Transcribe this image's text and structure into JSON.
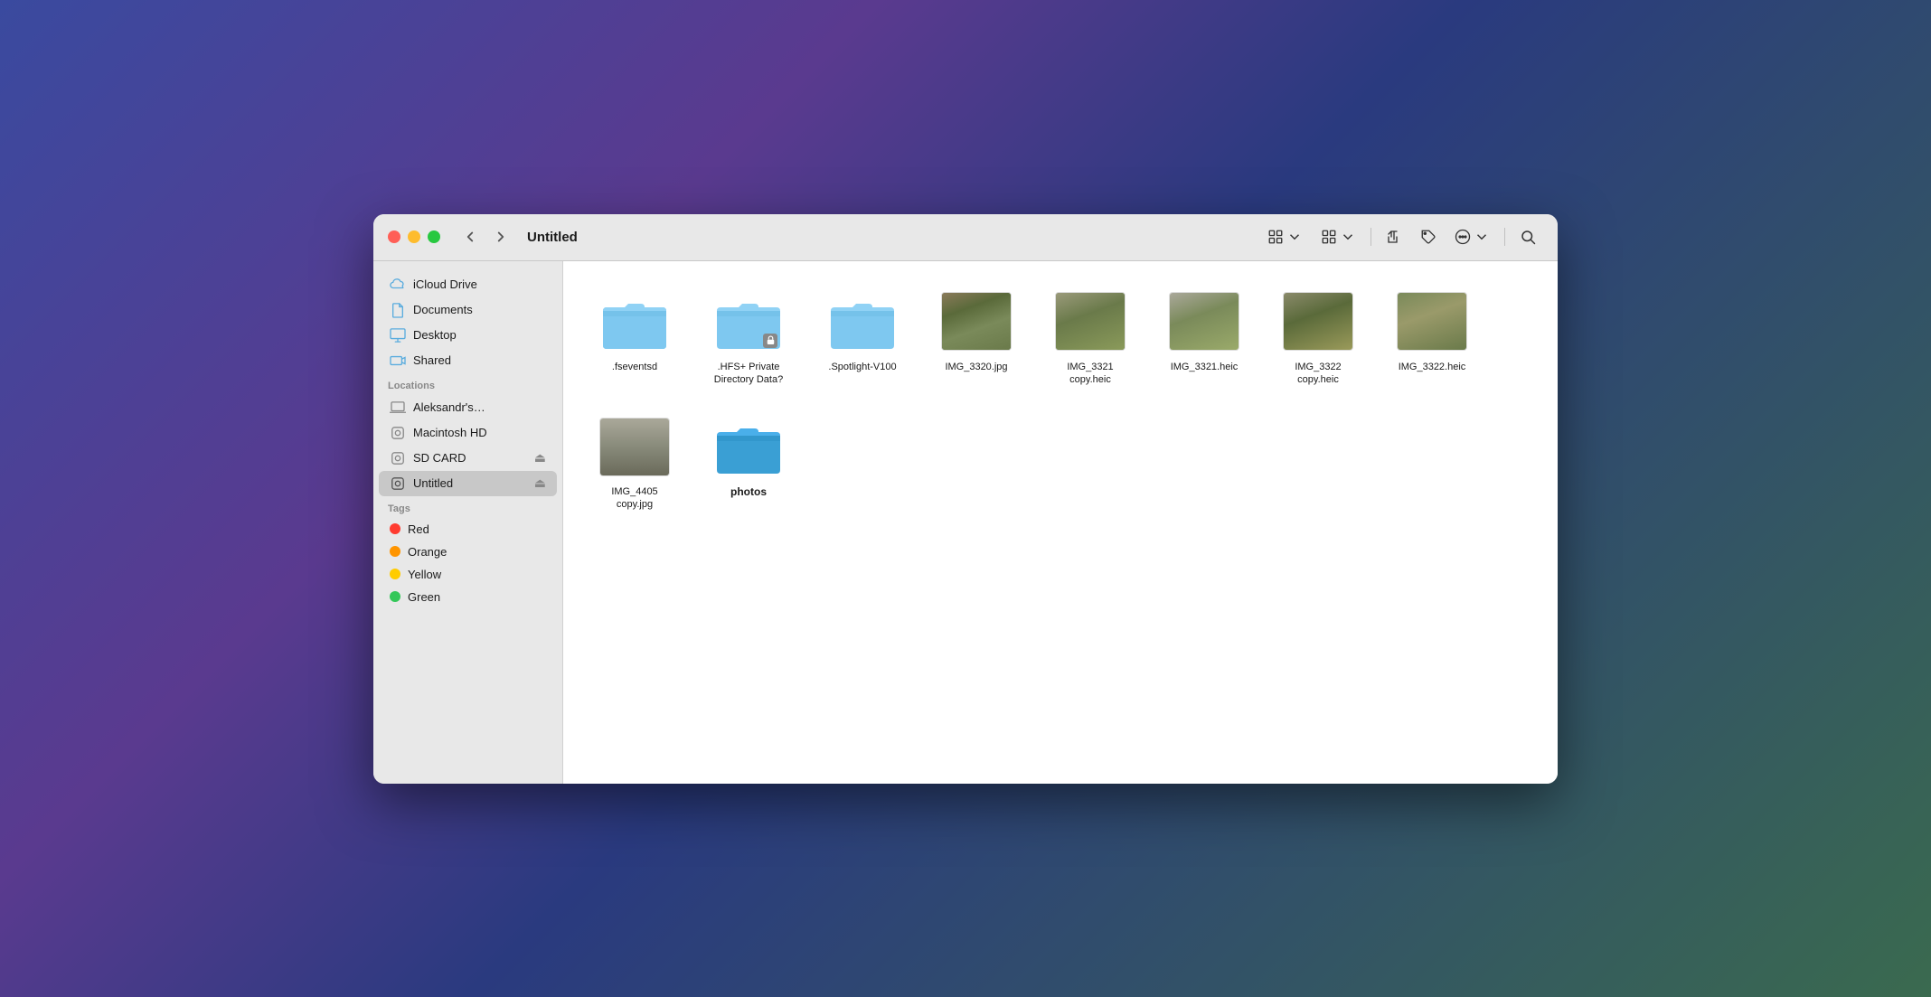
{
  "window": {
    "title": "Untitled"
  },
  "toolbar": {
    "back_label": "‹",
    "forward_label": "›",
    "title": "Untitled"
  },
  "sidebar": {
    "favorites": [
      {
        "id": "icloud-drive",
        "label": "iCloud Drive",
        "icon": "cloud"
      },
      {
        "id": "documents",
        "label": "Documents",
        "icon": "doc"
      },
      {
        "id": "desktop",
        "label": "Desktop",
        "icon": "desktop"
      },
      {
        "id": "shared",
        "label": "Shared",
        "icon": "shared"
      }
    ],
    "locations_header": "Locations",
    "locations": [
      {
        "id": "aleksandrs",
        "label": "Aleksandr's…",
        "icon": "laptop",
        "eject": false
      },
      {
        "id": "macintosh-hd",
        "label": "Macintosh HD",
        "icon": "disk",
        "eject": false
      },
      {
        "id": "sd-card",
        "label": "SD CARD",
        "icon": "disk",
        "eject": true
      },
      {
        "id": "untitled",
        "label": "Untitled",
        "icon": "disk",
        "eject": true,
        "active": true
      }
    ],
    "tags_header": "Tags",
    "tags": [
      {
        "id": "red",
        "label": "Red",
        "color": "#ff3b30"
      },
      {
        "id": "orange",
        "label": "Orange",
        "color": "#ff9500"
      },
      {
        "id": "yellow",
        "label": "Yellow",
        "color": "#ffcc00"
      },
      {
        "id": "green",
        "label": "Green",
        "color": "#34c759"
      }
    ]
  },
  "files": [
    {
      "id": "fseventsd",
      "name": ".fseventsd",
      "type": "folder",
      "dark": false
    },
    {
      "id": "hfs-private",
      "name": ".HFS+ Private Directory Data?",
      "type": "folder",
      "dark": false,
      "lock": true
    },
    {
      "id": "spotlight",
      "name": ".Spotlight-V100",
      "type": "folder",
      "dark": false
    },
    {
      "id": "img3320",
      "name": "IMG_3320.jpg",
      "type": "photo",
      "variant": 1
    },
    {
      "id": "img3321copy",
      "name": "IMG_3321 copy.heic",
      "type": "photo",
      "variant": 2
    },
    {
      "id": "img3321",
      "name": "IMG_3321.heic",
      "type": "photo",
      "variant": 3
    },
    {
      "id": "img3322copy",
      "name": "IMG_3322 copy.heic",
      "type": "photo",
      "variant": 4
    },
    {
      "id": "img3322",
      "name": "IMG_3322.heic",
      "type": "photo",
      "variant": 5
    },
    {
      "id": "img4405copy",
      "name": "IMG_4405 copy.jpg",
      "type": "photo",
      "variant": 3
    },
    {
      "id": "photos",
      "name": "photos",
      "type": "folder",
      "dark": true,
      "bold": true
    }
  ]
}
